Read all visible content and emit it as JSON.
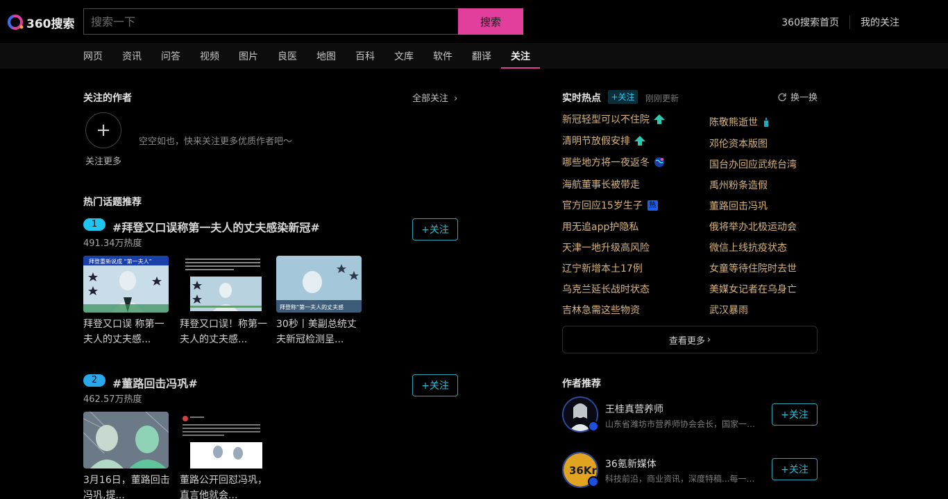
{
  "header": {
    "logo_text": "360搜索",
    "search_placeholder": "搜索一下",
    "search_button": "搜索",
    "links": [
      "360搜索首页",
      "我的关注"
    ]
  },
  "nav": {
    "tabs": [
      "网页",
      "资讯",
      "问答",
      "视频",
      "图片",
      "良医",
      "地图",
      "百科",
      "文库",
      "软件",
      "翻译",
      "关注"
    ],
    "active": "关注"
  },
  "followed_authors": {
    "title": "关注的作者",
    "all_follow": "全部关注",
    "follow_more": "关注更多",
    "empty_tip": "空空如也，快来关注更多优质作者吧～"
  },
  "hot_topics": {
    "title": "热门话题推荐",
    "follow_label": "+关注",
    "items": [
      {
        "rank": "1",
        "title": "#拜登又口误称第一夫人的丈夫感染新冠#",
        "heat": "491.34万热度",
        "thumbs": [
          {
            "caption": "拜登又口误 称第一夫人的丈夫感...",
            "overlay": "拜登重新说成 “第一夫人”"
          },
          {
            "caption": "拜登又口误！称第一夫人的丈夫感..."
          },
          {
            "caption": "30秒丨美副总统丈夫新冠检测呈...",
            "overlay": "拜登称“第一夫人的丈夫感"
          }
        ]
      },
      {
        "rank": "2",
        "title": "#董路回击冯巩#",
        "heat": "462.57万热度",
        "thumbs": [
          {
            "caption": "3月16日，董路回击冯巩,提..."
          },
          {
            "caption": "董路公开回怼冯巩，直言他就会..."
          }
        ]
      }
    ]
  },
  "realtime": {
    "title": "实时热点",
    "follow": "+关注",
    "updated": "刚刚更新",
    "refresh": "换一换",
    "left": [
      {
        "text": "新冠轻型可以不住院",
        "tag": "up"
      },
      {
        "text": "清明节放假安排",
        "tag": "up"
      },
      {
        "text": "哪些地方将一夜返冬",
        "tag": "globe"
      },
      {
        "text": "海航董事长被带走",
        "tag": ""
      },
      {
        "text": "官方回应15岁生子",
        "tag": "hot",
        "tag_text": "热"
      },
      {
        "text": "用无追app护隐私",
        "tag": ""
      },
      {
        "text": "天津一地升级高风险",
        "tag": ""
      },
      {
        "text": "辽宁新增本土17例",
        "tag": ""
      },
      {
        "text": "乌克兰延长战时状态",
        "tag": ""
      },
      {
        "text": "吉林急需这些物资",
        "tag": ""
      }
    ],
    "right": [
      {
        "text": "陈敬熊逝世",
        "tag": "candle"
      },
      {
        "text": "邓伦资本版图",
        "tag": ""
      },
      {
        "text": "国台办回应武统台湾",
        "tag": ""
      },
      {
        "text": "禹州粉条造假",
        "tag": ""
      },
      {
        "text": "董路回击冯巩",
        "tag": ""
      },
      {
        "text": "俄将举办北极运动会",
        "tag": ""
      },
      {
        "text": "微信上线抗疫状态",
        "tag": ""
      },
      {
        "text": "女童等待住院时去世",
        "tag": ""
      },
      {
        "text": "美媒女记者在乌身亡",
        "tag": ""
      },
      {
        "text": "武汉暴雨",
        "tag": ""
      }
    ],
    "see_more": "查看更多"
  },
  "authors": {
    "title": "作者推荐",
    "follow_label": "+关注",
    "items": [
      {
        "name": "王桂真营养师",
        "desc": "山东省潍坊市营养师协会会长，国家一级营养师",
        "avatar": "person"
      },
      {
        "name": "36氪新媒体",
        "desc": "科技前沿，商业资讯，深度特稿...每一篇都有料",
        "avatar": "kr",
        "avatar_text": "36Kr"
      }
    ]
  },
  "colors": {
    "accent_pink": "#e23f9c",
    "follow_cyan": "#27c1d9",
    "hot_gold": "#d9b47a"
  }
}
